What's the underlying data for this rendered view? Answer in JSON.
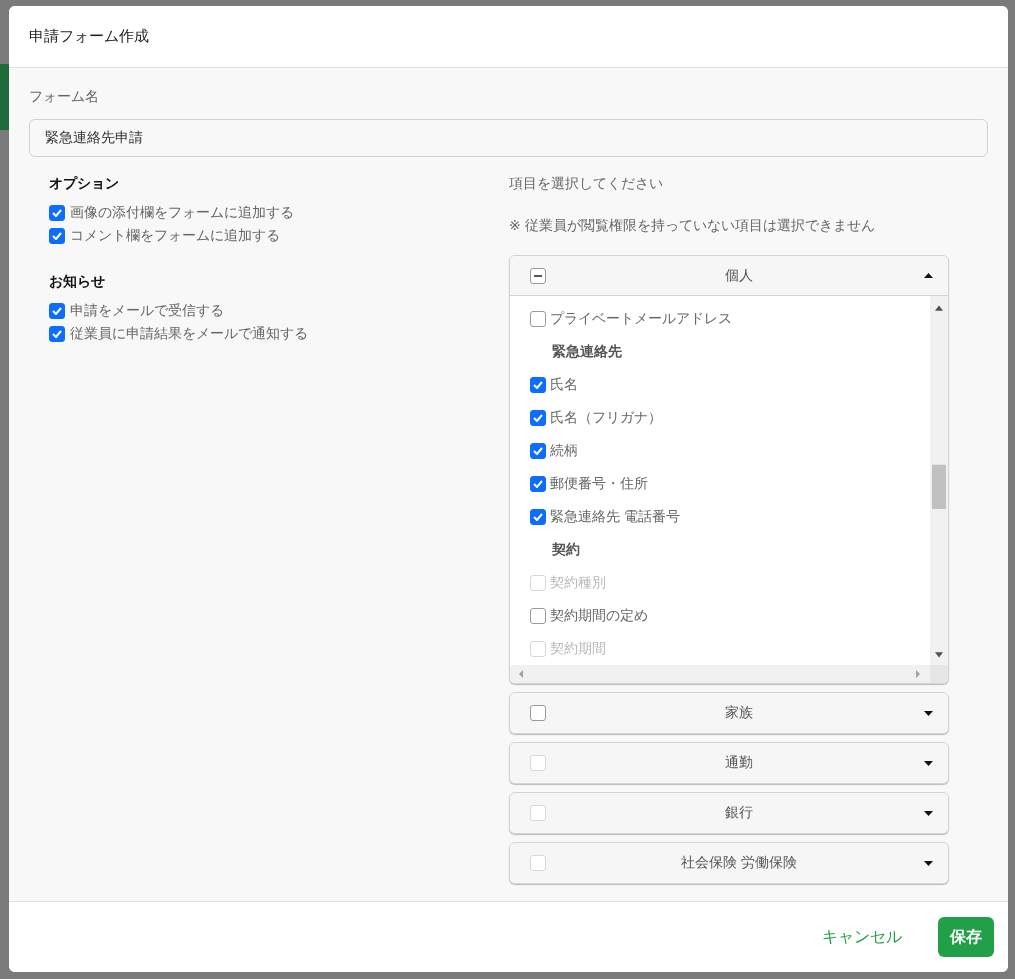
{
  "dialog": {
    "title": "申請フォーム作成"
  },
  "form_name": {
    "label": "フォーム名",
    "value": "緊急連絡先申請"
  },
  "option_sections": [
    {
      "title": "オプション",
      "items": [
        {
          "label": "画像の添付欄をフォームに追加する",
          "checked": true
        },
        {
          "label": "コメント欄をフォームに追加する",
          "checked": true
        }
      ]
    },
    {
      "title": "お知らせ",
      "items": [
        {
          "label": "申請をメールで受信する",
          "checked": true
        },
        {
          "label": "従業員に申請結果をメールで通知する",
          "checked": true
        }
      ]
    }
  ],
  "field_picker": {
    "instruction": "項目を選択してください",
    "note": "※ 従業員が閲覧権限を持っていない項目は選択できません",
    "groups": [
      {
        "label": "個人",
        "expanded": true,
        "indeterminate": true,
        "disabled": false,
        "rows": [
          {
            "kind": "option",
            "label": "プライベートメールアドレス",
            "checked": false,
            "disabled": false
          },
          {
            "kind": "heading",
            "label": "緊急連絡先"
          },
          {
            "kind": "option",
            "label": "氏名",
            "checked": true,
            "disabled": false
          },
          {
            "kind": "option",
            "label": "氏名（フリガナ）",
            "checked": true,
            "disabled": false
          },
          {
            "kind": "option",
            "label": "続柄",
            "checked": true,
            "disabled": false
          },
          {
            "kind": "option",
            "label": "郵便番号・住所",
            "checked": true,
            "disabled": false
          },
          {
            "kind": "option",
            "label": "緊急連絡先 電話番号",
            "checked": true,
            "disabled": false
          },
          {
            "kind": "heading",
            "label": "契約"
          },
          {
            "kind": "option",
            "label": "契約種別",
            "checked": false,
            "disabled": true
          },
          {
            "kind": "option",
            "label": "契約期間の定め",
            "checked": false,
            "disabled": false
          },
          {
            "kind": "option",
            "label": "契約期間",
            "checked": false,
            "disabled": true
          }
        ]
      },
      {
        "label": "家族",
        "expanded": false,
        "indeterminate": false,
        "disabled": false
      },
      {
        "label": "通勤",
        "expanded": false,
        "indeterminate": false,
        "disabled": true
      },
      {
        "label": "銀行",
        "expanded": false,
        "indeterminate": false,
        "disabled": true
      },
      {
        "label": "社会保険 労働保険",
        "expanded": false,
        "indeterminate": false,
        "disabled": true
      }
    ]
  },
  "buttons": [
    {
      "label": "キャンセル",
      "kind": "link"
    },
    {
      "label": "保存",
      "kind": "primary"
    }
  ]
}
